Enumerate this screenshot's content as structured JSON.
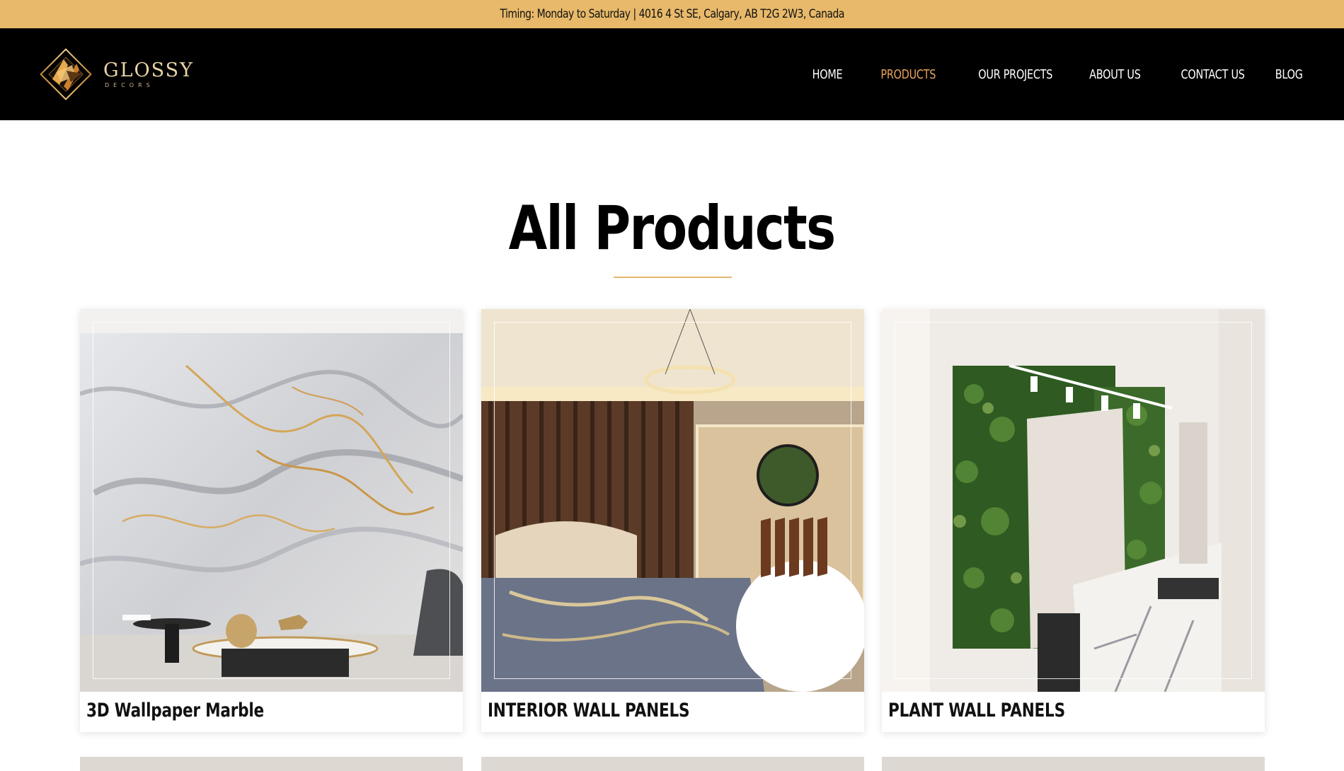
{
  "topbar": {
    "text": "Timing: Monday to Saturday | 4016 4 St SE, Calgary, AB T2G 2W3, Canada"
  },
  "logo": {
    "title": "GLOSSY",
    "subtitle": "DECORS"
  },
  "nav": {
    "items": [
      {
        "label": "HOME",
        "active": false
      },
      {
        "label": "PRODUCTS",
        "active": true
      },
      {
        "label": "OUR PROJECTS",
        "active": false
      },
      {
        "label": "ABOUT US",
        "active": false
      },
      {
        "label": "CONTACT US",
        "active": false
      },
      {
        "label": "BLOG",
        "active": false
      }
    ]
  },
  "page": {
    "heading": "All Products"
  },
  "products": [
    {
      "title": "3D Wallpaper Marble"
    },
    {
      "title": "INTERIOR WALL PANELS"
    },
    {
      "title": "PLANT WALL PANELS"
    }
  ],
  "colors": {
    "accent": "#e8b96a",
    "nav_active": "#e8a45c",
    "navbar_bg": "#000000"
  }
}
